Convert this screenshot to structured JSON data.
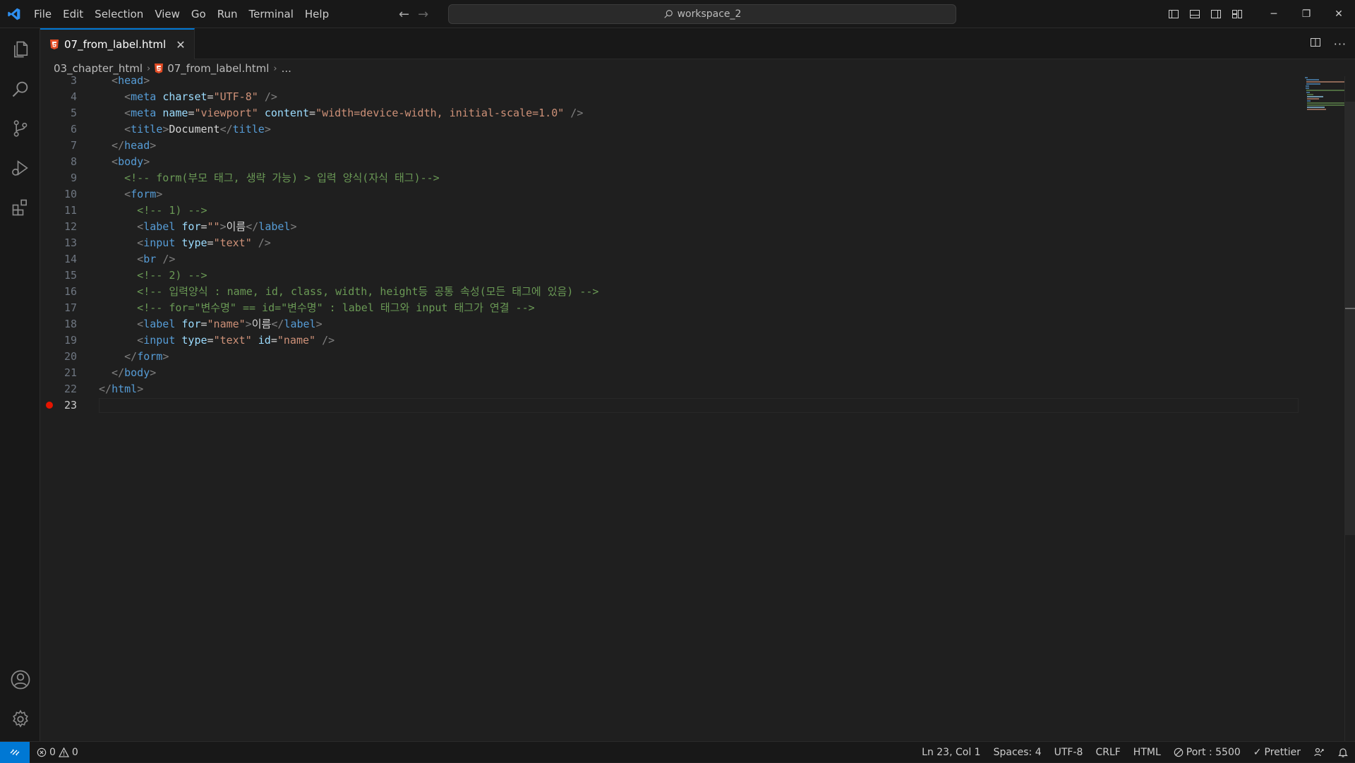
{
  "menu": [
    "File",
    "Edit",
    "Selection",
    "View",
    "Go",
    "Run",
    "Terminal",
    "Help"
  ],
  "search": {
    "text": "workspace_2"
  },
  "tab": {
    "label": "07_from_label.html"
  },
  "breadcrumb": {
    "folder": "03_chapter_html",
    "file": "07_from_label.html",
    "more": "..."
  },
  "editor": {
    "line_numbers": [
      "3",
      "4",
      "5",
      "6",
      "7",
      "8",
      "9",
      "10",
      "11",
      "12",
      "13",
      "14",
      "15",
      "16",
      "17",
      "18",
      "19",
      "20",
      "21",
      "22",
      "23"
    ],
    "active_line": "23",
    "lines": [
      [
        [
          "b",
          "  <"
        ],
        [
          "tag",
          "head"
        ],
        [
          "b",
          ">"
        ]
      ],
      [
        [
          "b",
          "    <"
        ],
        [
          "tag",
          "meta"
        ],
        [
          "txt",
          " "
        ],
        [
          "attr",
          "charset"
        ],
        [
          "txt",
          "="
        ],
        [
          "str",
          "\"UTF-8\""
        ],
        [
          "txt",
          " "
        ],
        [
          "b",
          "/>"
        ]
      ],
      [
        [
          "b",
          "    <"
        ],
        [
          "tag",
          "meta"
        ],
        [
          "txt",
          " "
        ],
        [
          "attr",
          "name"
        ],
        [
          "txt",
          "="
        ],
        [
          "str",
          "\"viewport\""
        ],
        [
          "txt",
          " "
        ],
        [
          "attr",
          "content"
        ],
        [
          "txt",
          "="
        ],
        [
          "str",
          "\"width=device-width, initial-scale=1.0\""
        ],
        [
          "txt",
          " "
        ],
        [
          "b",
          "/>"
        ]
      ],
      [
        [
          "b",
          "    <"
        ],
        [
          "tag",
          "title"
        ],
        [
          "b",
          ">"
        ],
        [
          "txt",
          "Document"
        ],
        [
          "b",
          "</"
        ],
        [
          "tag",
          "title"
        ],
        [
          "b",
          ">"
        ]
      ],
      [
        [
          "b",
          "  </"
        ],
        [
          "tag",
          "head"
        ],
        [
          "b",
          ">"
        ]
      ],
      [
        [
          "b",
          "  <"
        ],
        [
          "tag",
          "body"
        ],
        [
          "b",
          ">"
        ]
      ],
      [
        [
          "com",
          "    <!-- form(부모 태그, 생략 가능) > 입력 양식(자식 태그)-->"
        ]
      ],
      [
        [
          "b",
          "    <"
        ],
        [
          "tag",
          "form"
        ],
        [
          "b",
          ">"
        ]
      ],
      [
        [
          "com",
          "      <!-- 1) -->"
        ]
      ],
      [
        [
          "b",
          "      <"
        ],
        [
          "tag",
          "label"
        ],
        [
          "txt",
          " "
        ],
        [
          "attr",
          "for"
        ],
        [
          "txt",
          "="
        ],
        [
          "str",
          "\"\""
        ],
        [
          "b",
          ">"
        ],
        [
          "txt",
          "이름"
        ],
        [
          "b",
          "</"
        ],
        [
          "tag",
          "label"
        ],
        [
          "b",
          ">"
        ]
      ],
      [
        [
          "b",
          "      <"
        ],
        [
          "tag",
          "input"
        ],
        [
          "txt",
          " "
        ],
        [
          "attr",
          "type"
        ],
        [
          "txt",
          "="
        ],
        [
          "str",
          "\"text\""
        ],
        [
          "txt",
          " "
        ],
        [
          "b",
          "/>"
        ]
      ],
      [
        [
          "b",
          "      <"
        ],
        [
          "tag",
          "br"
        ],
        [
          "txt",
          " "
        ],
        [
          "b",
          "/>"
        ]
      ],
      [
        [
          "com",
          "      <!-- 2) -->"
        ]
      ],
      [
        [
          "com",
          "      <!-- 입력양식 : name, id, class, width, height등 공통 속성(모든 태그에 있음) -->"
        ]
      ],
      [
        [
          "com",
          "      <!-- for=\"변수명\" == id=\"변수명\" : label 태그와 input 태그가 연결 -->"
        ]
      ],
      [
        [
          "b",
          "      <"
        ],
        [
          "tag",
          "label"
        ],
        [
          "txt",
          " "
        ],
        [
          "attr",
          "for"
        ],
        [
          "txt",
          "="
        ],
        [
          "str",
          "\"name\""
        ],
        [
          "b",
          ">"
        ],
        [
          "txt",
          "이름"
        ],
        [
          "b",
          "</"
        ],
        [
          "tag",
          "label"
        ],
        [
          "b",
          ">"
        ]
      ],
      [
        [
          "b",
          "      <"
        ],
        [
          "tag",
          "input"
        ],
        [
          "txt",
          " "
        ],
        [
          "attr",
          "type"
        ],
        [
          "txt",
          "="
        ],
        [
          "str",
          "\"text\""
        ],
        [
          "txt",
          " "
        ],
        [
          "attr",
          "id"
        ],
        [
          "txt",
          "="
        ],
        [
          "str",
          "\"name\""
        ],
        [
          "txt",
          " "
        ],
        [
          "b",
          "/>"
        ]
      ],
      [
        [
          "b",
          "    </"
        ],
        [
          "tag",
          "form"
        ],
        [
          "b",
          ">"
        ]
      ],
      [
        [
          "b",
          "  </"
        ],
        [
          "tag",
          "body"
        ],
        [
          "b",
          ">"
        ]
      ],
      [
        [
          "b",
          "</"
        ],
        [
          "tag",
          "html"
        ],
        [
          "b",
          ">"
        ]
      ],
      [
        [
          "txt",
          ""
        ]
      ]
    ]
  },
  "status": {
    "errors": "0",
    "warnings": "0",
    "position": "Ln 23, Col 1",
    "spaces": "Spaces: 4",
    "encoding": "UTF-8",
    "eol": "CRLF",
    "language": "HTML",
    "port": "Port : 5500",
    "prettier": "Prettier"
  },
  "colors": {
    "accent": "#0078d4",
    "breakpoint": "#e51400",
    "html_icon": "#e44d26"
  }
}
